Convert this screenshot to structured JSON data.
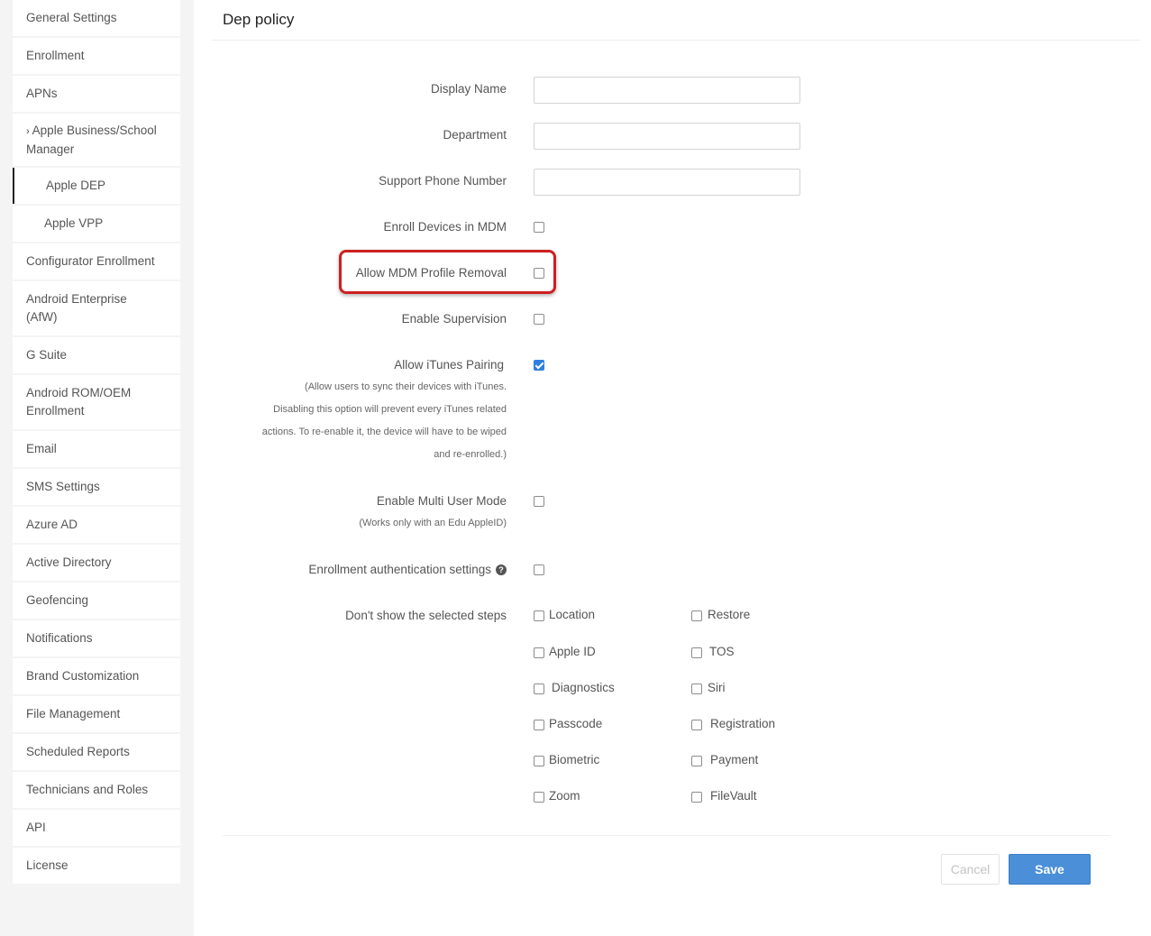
{
  "sidebar": {
    "items": [
      {
        "label": "General Settings"
      },
      {
        "label": "Enrollment"
      },
      {
        "label": "APNs"
      },
      {
        "label": "Apple Business/School",
        "label2": "Manager",
        "chevron": "›"
      },
      {
        "label": "Apple DEP",
        "active": true
      },
      {
        "label": "Apple VPP"
      },
      {
        "label": "Configurator Enrollment"
      },
      {
        "label": "Android Enterprise",
        "label2": "(AfW)"
      },
      {
        "label": "G Suite"
      },
      {
        "label": "Android ROM/OEM",
        "label2": "Enrollment"
      },
      {
        "label": "Email"
      },
      {
        "label": "SMS Settings"
      },
      {
        "label": "Azure AD"
      },
      {
        "label": "Active Directory"
      },
      {
        "label": "Geofencing"
      },
      {
        "label": "Notifications"
      },
      {
        "label": "Brand Customization"
      },
      {
        "label": "File Management"
      },
      {
        "label": "Scheduled Reports"
      },
      {
        "label": "Technicians and Roles"
      },
      {
        "label": "API"
      },
      {
        "label": "License"
      }
    ]
  },
  "page": {
    "title": "Dep policy"
  },
  "form": {
    "display_name": {
      "label": "Display Name",
      "value": ""
    },
    "department": {
      "label": "Department",
      "value": ""
    },
    "support_phone": {
      "label": "Support Phone Number",
      "value": ""
    },
    "enroll_mdm": {
      "label": "Enroll Devices in MDM",
      "checked": false
    },
    "allow_profile_removal": {
      "label": "Allow MDM Profile Removal",
      "checked": false
    },
    "enable_supervision": {
      "label": "Enable Supervision",
      "checked": false
    },
    "itunes_pairing": {
      "label": "Allow iTunes Pairing",
      "checked": true,
      "note": [
        "(Allow users to sync their devices with iTunes.",
        "Disabling this option will prevent every iTunes related",
        "actions. To re-enable it, the device will have to be wiped",
        "and re-enrolled.)"
      ]
    },
    "multi_user": {
      "label": "Enable Multi User Mode",
      "note": "(Works only with an Edu AppleID)",
      "checked": false
    },
    "enrollment_auth": {
      "label": "Enrollment authentication settings",
      "help_icon": "?",
      "checked": false
    },
    "skip_steps": {
      "label": "Don't show the selected steps",
      "col1": [
        "Location",
        "Apple ID",
        "Diagnostics",
        "Passcode",
        "Biometric",
        "Zoom"
      ],
      "col2": [
        "Restore",
        "TOS",
        "Siri",
        "Registration",
        "Payment",
        "FileVault"
      ]
    }
  },
  "footer": {
    "cancel_label": "Cancel",
    "save_label": "Save"
  },
  "colors": {
    "accent": "#4a8fd8",
    "highlight": "#cc2020",
    "checked": "#2d7fe0"
  }
}
